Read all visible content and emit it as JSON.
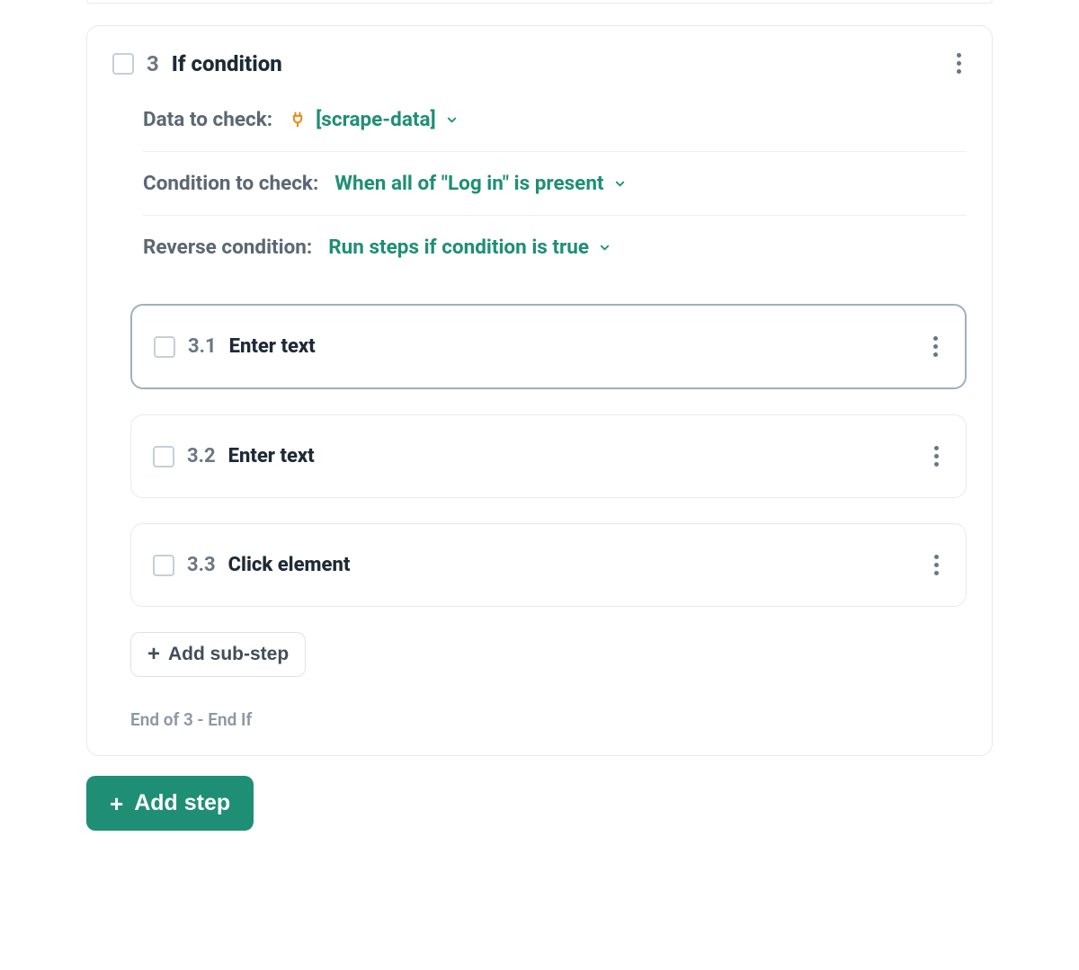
{
  "step": {
    "number": "3",
    "title": "If condition",
    "settings": {
      "data_to_check": {
        "label": "Data to check:",
        "value": "[scrape-data]"
      },
      "condition": {
        "label": "Condition to check:",
        "value": "When all of \"Log in\" is present"
      },
      "reverse": {
        "label": "Reverse condition:",
        "value": "Run steps if condition is true"
      }
    },
    "substeps": [
      {
        "number": "3.1",
        "title": "Enter text",
        "selected": true
      },
      {
        "number": "3.2",
        "title": "Enter text",
        "selected": false
      },
      {
        "number": "3.3",
        "title": "Click element",
        "selected": false
      }
    ],
    "add_substep_label": "Add sub-step",
    "end_label": "End of 3 - End If"
  },
  "add_step_label": "Add step"
}
